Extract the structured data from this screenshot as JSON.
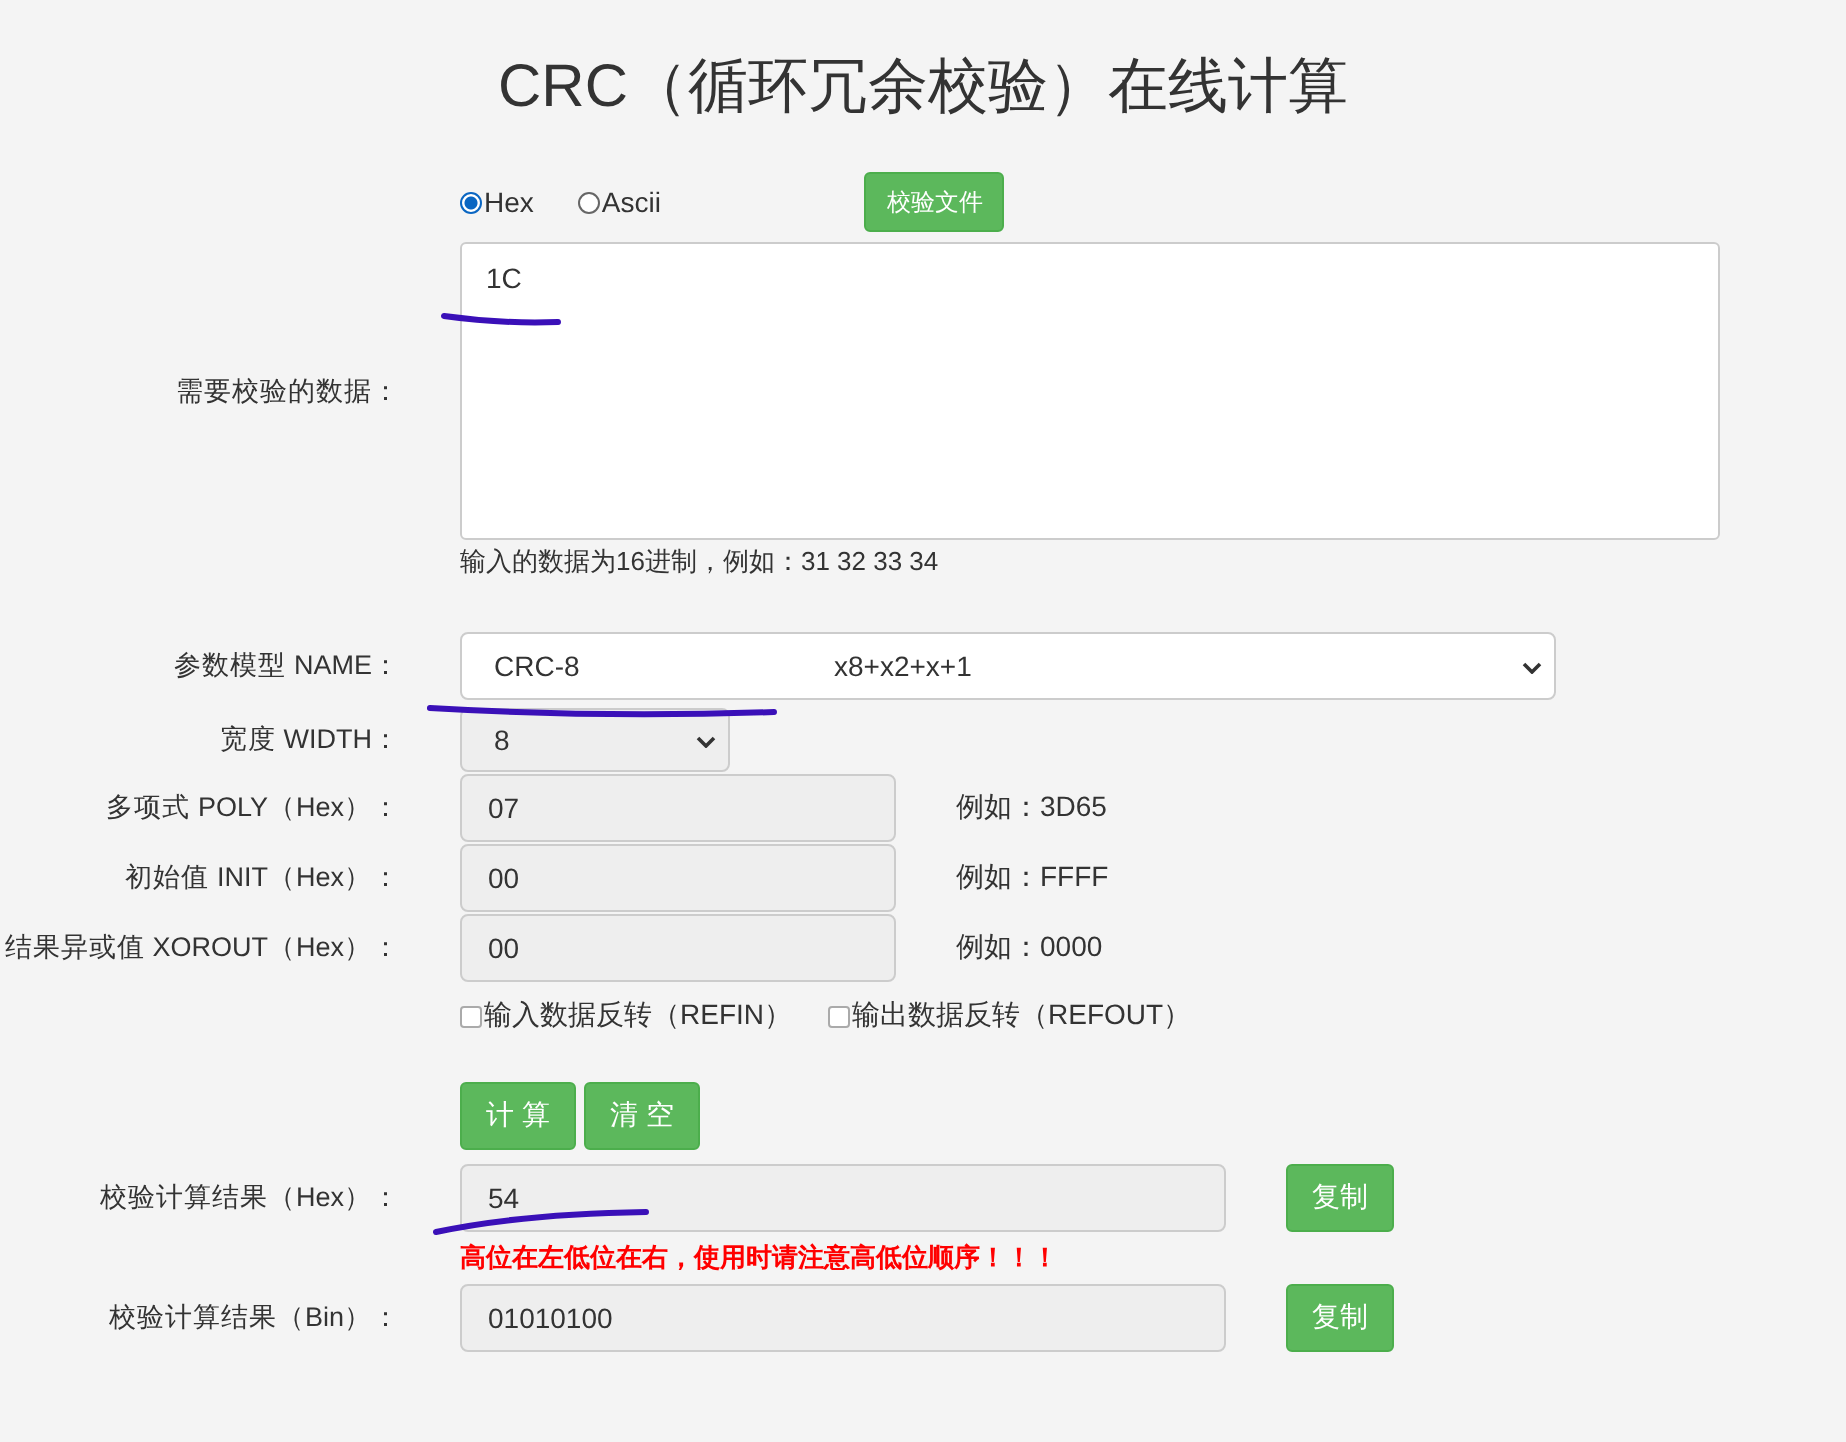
{
  "title": "CRC（循环冗余校验）在线计算",
  "input_format": [
    {
      "label": "Hex",
      "selected": true
    },
    {
      "label": "Ascii",
      "selected": false
    }
  ],
  "verify_file_button": "校验文件",
  "data_field": {
    "label": "需要校验的数据：",
    "value": "1C",
    "hint": "输入的数据为16进制，例如：31 32 33 34"
  },
  "model": {
    "label": "参数模型 NAME：",
    "name": "CRC-8",
    "polynomial": "x8+x2+x+1"
  },
  "width": {
    "label": "宽度 WIDTH：",
    "value": "8"
  },
  "params": [
    {
      "label": "多项式 POLY（Hex）：",
      "value": "07",
      "example": "例如：3D65"
    },
    {
      "label": "初始值 INIT（Hex）：",
      "value": "00",
      "example": "例如：FFFF"
    },
    {
      "label": "结果异或值 XOROUT（Hex）：",
      "value": "00",
      "example": "例如：0000"
    }
  ],
  "options": [
    {
      "label": "输入数据反转（REFIN）",
      "checked": false
    },
    {
      "label": "输出数据反转（REFOUT）",
      "checked": false
    }
  ],
  "actions": [
    "计 算",
    "清 空"
  ],
  "results": [
    {
      "label": "校验计算结果（Hex）：",
      "value": "54",
      "copy": "复制",
      "warning": "高位在左低位在右，使用时请注意高低位顺序！！！"
    },
    {
      "label": "校验计算结果（Bin）：",
      "value": "01010100",
      "copy": "复制"
    }
  ]
}
